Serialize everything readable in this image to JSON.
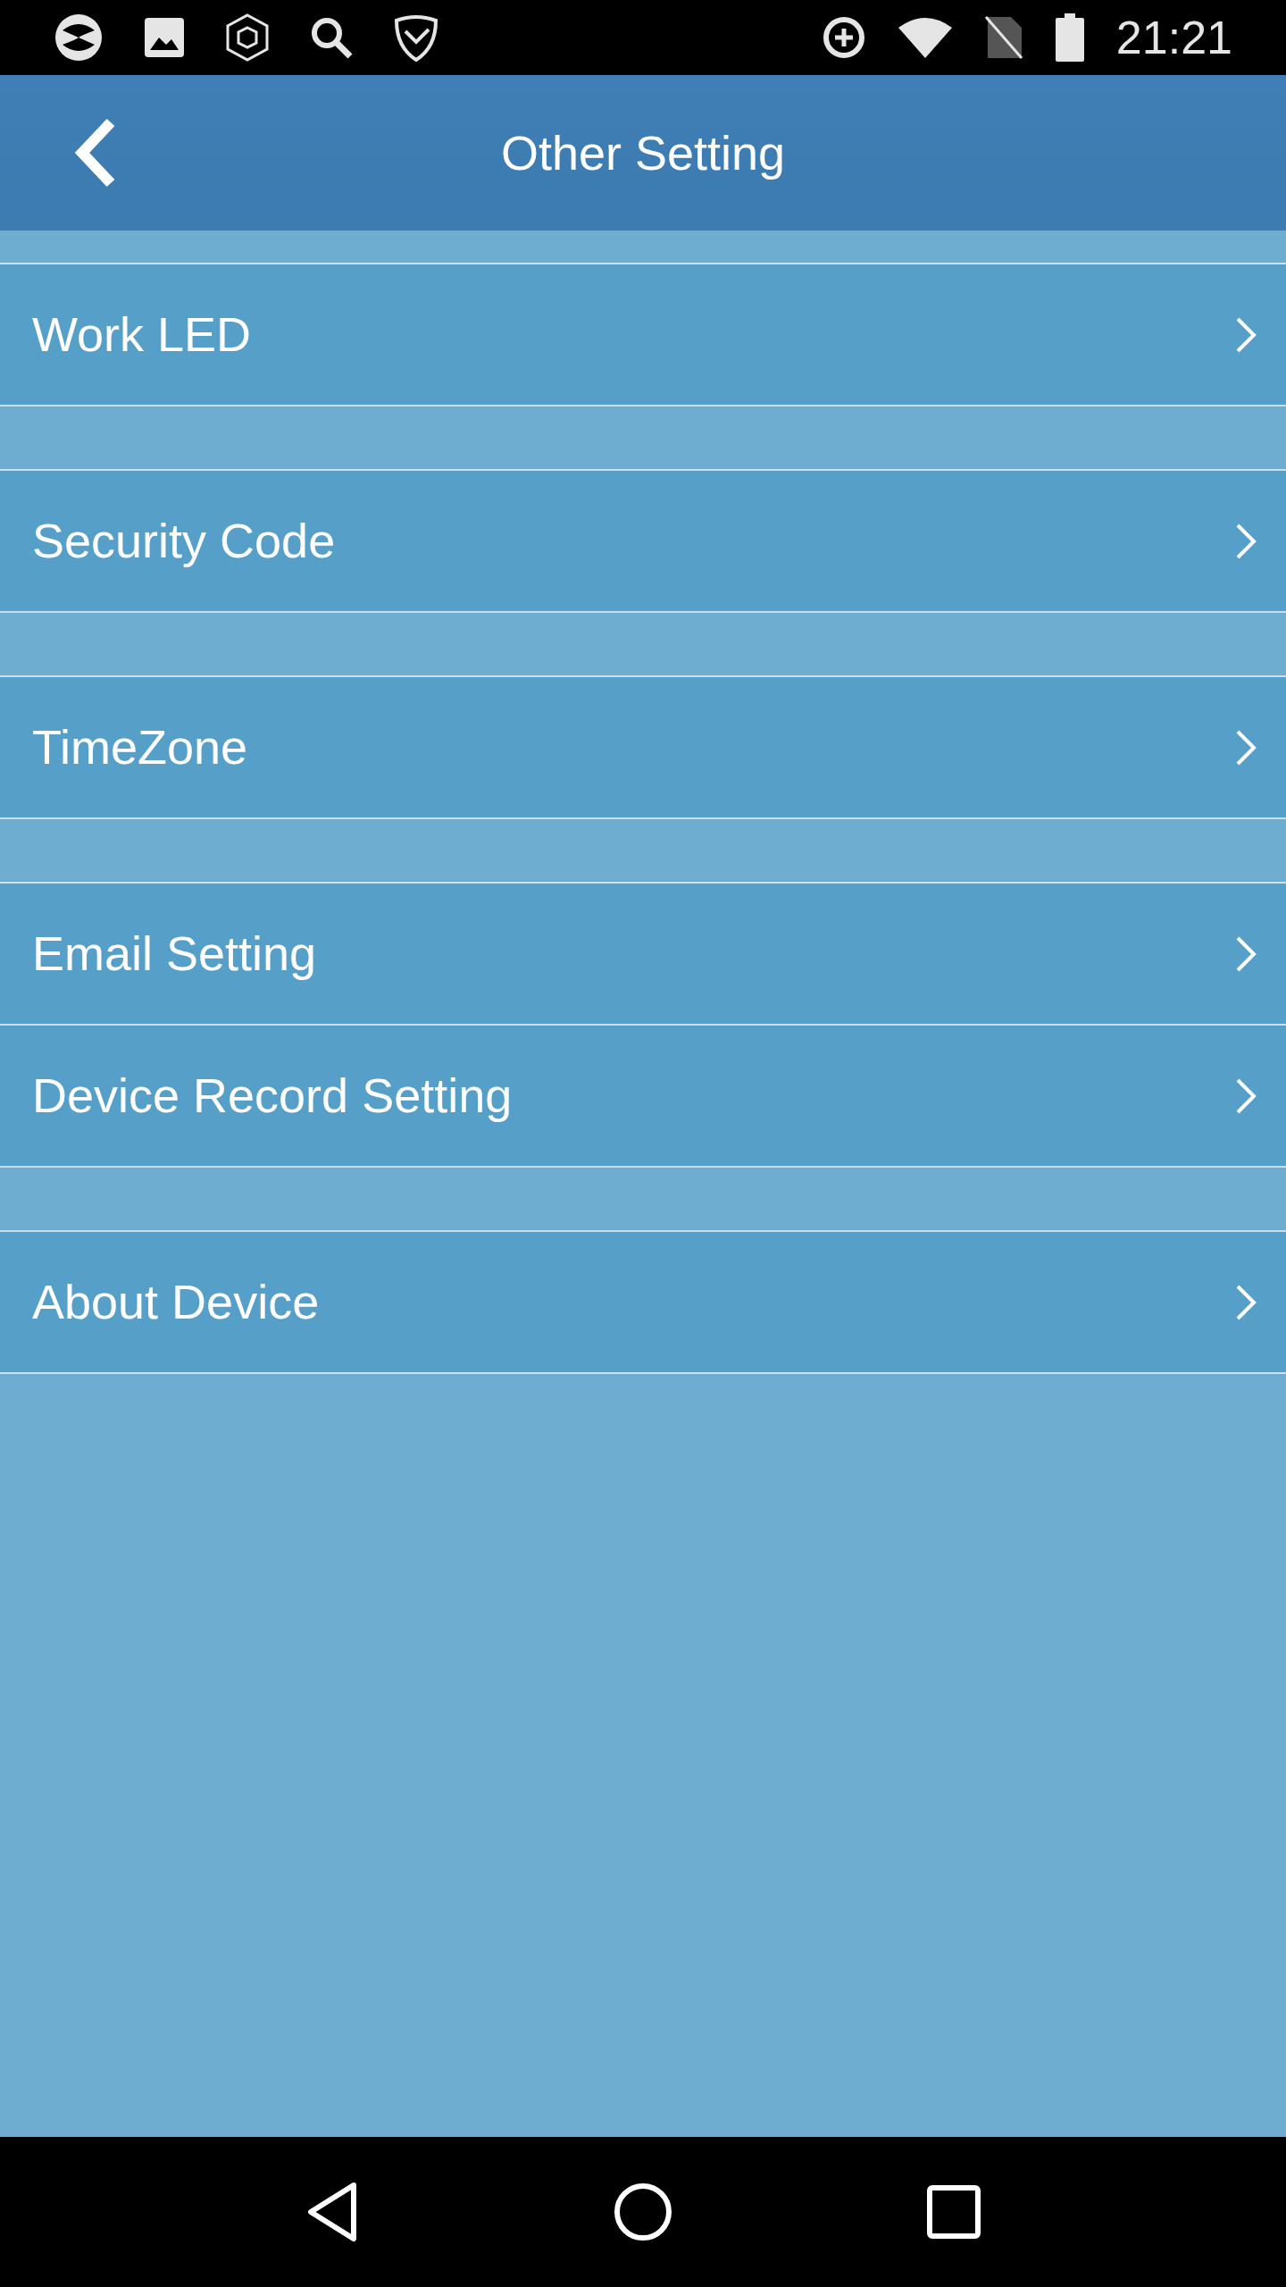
{
  "status_bar": {
    "time": "21:21"
  },
  "header": {
    "title": "Other Setting"
  },
  "groups": [
    {
      "items": [
        {
          "label": "Work LED"
        }
      ]
    },
    {
      "items": [
        {
          "label": "Security Code"
        }
      ]
    },
    {
      "items": [
        {
          "label": "TimeZone"
        }
      ]
    },
    {
      "items": [
        {
          "label": "Email Setting"
        },
        {
          "label": "Device Record Setting"
        }
      ]
    },
    {
      "items": [
        {
          "label": "About Device"
        }
      ]
    }
  ]
}
